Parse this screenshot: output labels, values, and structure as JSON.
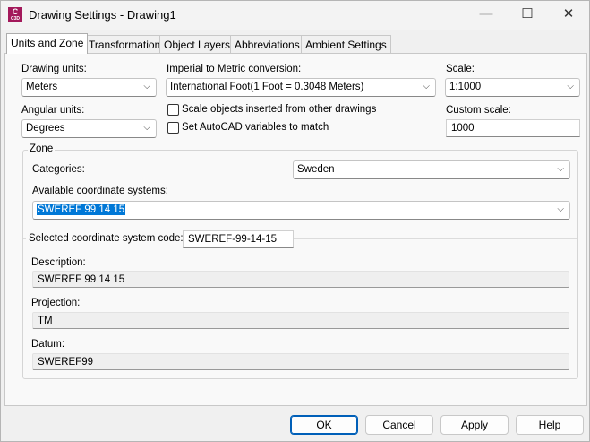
{
  "window": {
    "title": "Drawing Settings - Drawing1",
    "app_icon_text": "C",
    "app_icon_sub": "C3D",
    "minimize": "—",
    "maximize": "☐",
    "close": "✕"
  },
  "tabs": [
    {
      "label": "Units and Zone"
    },
    {
      "label": "Transformation"
    },
    {
      "label": "Object Layers"
    },
    {
      "label": "Abbreviations"
    },
    {
      "label": "Ambient Settings"
    }
  ],
  "units": {
    "drawing_units_label": "Drawing units:",
    "drawing_units": "Meters",
    "imperial_label": "Imperial to Metric conversion:",
    "imperial": "International Foot(1 Foot = 0.3048 Meters)",
    "scale_label": "Scale:",
    "scale": "1:1000",
    "angular_label": "Angular units:",
    "angular": "Degrees",
    "scale_objects_label": "Scale objects inserted from other drawings",
    "scale_objects_checked": false,
    "set_vars_label": "Set AutoCAD variables to match",
    "set_vars_checked": false,
    "custom_scale_label": "Custom scale:",
    "custom_scale": "1000"
  },
  "zone": {
    "title": "Zone",
    "categories_label": "Categories:",
    "categories": "Sweden",
    "available_label": "Available coordinate systems:",
    "available": "SWEREF 99 14 15",
    "code_label": "Selected coordinate system code:",
    "code": "SWEREF-99-14-15",
    "description_label": "Description:",
    "description": "SWEREF 99 14 15",
    "projection_label": "Projection:",
    "projection": "TM",
    "datum_label": "Datum:",
    "datum": "SWEREF99"
  },
  "buttons": {
    "ok": "OK",
    "cancel": "Cancel",
    "apply": "Apply",
    "help": "Help"
  },
  "icons": {
    "chevron": "⌵"
  }
}
